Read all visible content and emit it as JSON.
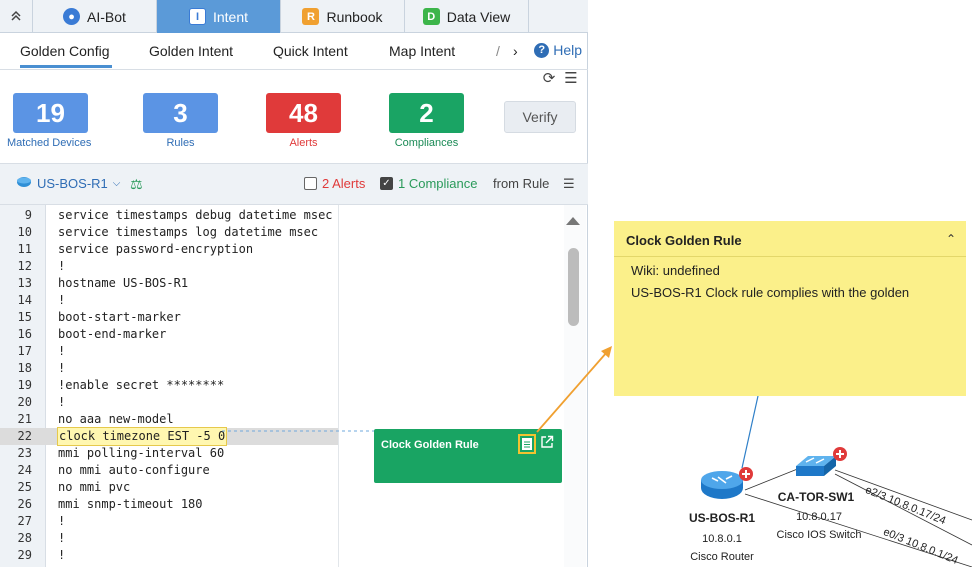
{
  "top_tabs": [
    {
      "label": "AI-Bot",
      "icon": "robot-icon"
    },
    {
      "label": "Intent",
      "icon": "intent-icon",
      "active": true
    },
    {
      "label": "Runbook",
      "icon": "runbook-icon"
    },
    {
      "label": "Data View",
      "icon": "dataview-icon"
    }
  ],
  "sub_tabs": {
    "golden_config": "Golden Config",
    "golden_intent": "Golden Intent",
    "quick_intent": "Quick Intent",
    "map_intent": "Map Intent",
    "overflow": "/",
    "help": "Help"
  },
  "stats": {
    "matched_devices": {
      "value": "19",
      "label": "Matched Devices",
      "color": "#5b94e4"
    },
    "rules": {
      "value": "3",
      "label": "Rules",
      "color": "#5b94e4"
    },
    "alerts": {
      "value": "48",
      "label": "Alerts",
      "color": "#e03a3a"
    },
    "compliances": {
      "value": "2",
      "label": "Compliances",
      "color": "#1aa464"
    },
    "verify_label": "Verify"
  },
  "device_bar": {
    "device": "US-BOS-R1",
    "alerts_label": "2 Alerts",
    "compliance_label": "1 Compliance",
    "from_rule": "from Rule"
  },
  "code_lines": [
    {
      "n": "9",
      "t": "service timestamps debug datetime msec"
    },
    {
      "n": "10",
      "t": "service timestamps log datetime msec"
    },
    {
      "n": "11",
      "t": "service password-encryption"
    },
    {
      "n": "12",
      "t": "!"
    },
    {
      "n": "13",
      "t": "hostname US-BOS-R1"
    },
    {
      "n": "14",
      "t": "!"
    },
    {
      "n": "15",
      "t": "boot-start-marker"
    },
    {
      "n": "16",
      "t": "boot-end-marker"
    },
    {
      "n": "17",
      "t": "!"
    },
    {
      "n": "18",
      "t": "!"
    },
    {
      "n": "19",
      "t": "!enable secret ********"
    },
    {
      "n": "20",
      "t": "!"
    },
    {
      "n": "21",
      "t": "no aaa new-model"
    },
    {
      "n": "22",
      "t": "clock timezone EST -5 0",
      "highlight": true
    },
    {
      "n": "23",
      "t": "mmi polling-interval 60"
    },
    {
      "n": "24",
      "t": "no mmi auto-configure"
    },
    {
      "n": "25",
      "t": "no mmi pvc"
    },
    {
      "n": "26",
      "t": "mmi snmp-timeout 180"
    },
    {
      "n": "27",
      "t": "!"
    },
    {
      "n": "28",
      "t": "!"
    },
    {
      "n": "29",
      "t": "!"
    }
  ],
  "rule_card": {
    "title": "Clock Golden Rule"
  },
  "note": {
    "title": "Clock Golden Rule",
    "wiki": "Wiki: undefined",
    "message": "US-BOS-R1 Clock rule complies with the golden"
  },
  "map": {
    "router": {
      "name": "US-BOS-R1",
      "ip": "10.8.0.1",
      "type": "Cisco Router"
    },
    "switch": {
      "name": "CA-TOR-SW1",
      "ip": "10.8.0.17",
      "type": "Cisco IOS Switch"
    },
    "links": [
      {
        "label": "e2/3 10.8.0.17/24"
      },
      {
        "label": "e0/3 10.8.0.1/24"
      }
    ]
  }
}
